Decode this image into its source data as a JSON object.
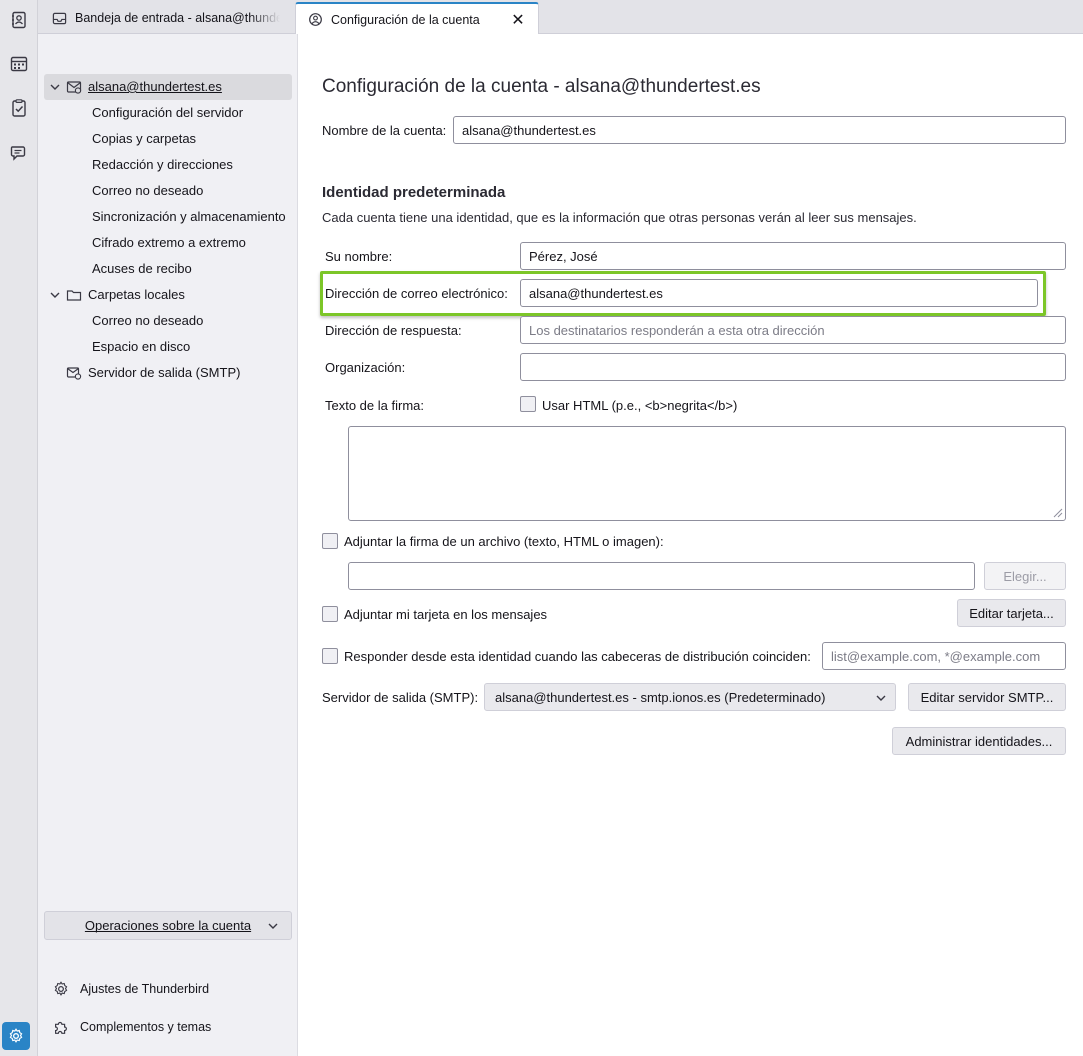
{
  "colors": {
    "accent": "#2a84c6",
    "highlight": "#7cc628"
  },
  "spaces": [
    {
      "name": "address-book-icon"
    },
    {
      "name": "calendar-icon"
    },
    {
      "name": "tasks-icon"
    },
    {
      "name": "chat-icon"
    },
    {
      "name": "settings-icon"
    }
  ],
  "tabs": [
    {
      "label": "Bandeja de entrada - alsana@thundertest.es",
      "active": false,
      "icon": "inbox-icon"
    },
    {
      "label": "Configuración de la cuenta",
      "active": true,
      "icon": "account-settings-icon",
      "close_icon": "✕"
    }
  ],
  "sidebar": {
    "account": "alsana@thundertest.es",
    "account_items": [
      "Configuración del servidor",
      "Copias y carpetas",
      "Redacción y direcciones",
      "Correo no deseado",
      "Sincronización y almacenamiento",
      "Cifrado extremo a extremo",
      "Acuses de recibo"
    ],
    "local_folders": "Carpetas locales",
    "local_items": [
      "Correo no deseado",
      "Espacio en disco"
    ],
    "smtp": "Servidor de salida (SMTP)",
    "account_ops": "Operaciones sobre la cuenta",
    "footer": {
      "settings": "Ajustes de Thunderbird",
      "addons": "Complementos y temas"
    }
  },
  "main": {
    "title": "Configuración de la cuenta - alsana@thundertest.es",
    "account_name_label": "Nombre de la cuenta:",
    "account_name_value": "alsana@thundertest.es",
    "identity_title": "Identidad predeterminada",
    "identity_desc": "Cada cuenta tiene una identidad, que es la información que otras personas verán al leer sus mensajes.",
    "name_label": "Su nombre:",
    "name_value": "Pérez, José",
    "email_label": "Dirección de correo electrónico:",
    "email_value": "alsana@thundertest.es",
    "reply_label": "Dirección de respuesta:",
    "reply_placeholder": "Los destinatarios responderán a esta otra dirección",
    "org_label": "Organización:",
    "org_value": "",
    "signature_label": "Texto de la firma:",
    "use_html_label": "Usar HTML (p.e., <b>negrita</b>)",
    "attach_sig_label": "Adjuntar la firma de un archivo (texto, HTML o imagen):",
    "choose_button": "Elegir...",
    "attach_card_label": "Adjuntar mi tarjeta en los mensajes",
    "edit_card_button": "Editar tarjeta...",
    "reply_from_label": "Responder desde esta identidad cuando las cabeceras de distribución coinciden:",
    "reply_from_placeholder": "list@example.com, *@example.com",
    "smtp_label": "Servidor de salida (SMTP):",
    "smtp_value": "alsana@thundertest.es - smtp.ionos.es (Predeterminado)",
    "edit_smtp_button": "Editar servidor SMTP...",
    "manage_identities_button": "Administrar identidades..."
  }
}
